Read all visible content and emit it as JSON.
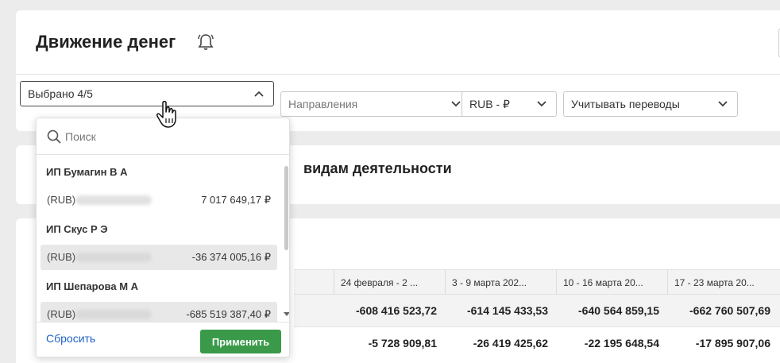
{
  "page": {
    "title": "Движение денег"
  },
  "filters": {
    "company": {
      "value": "Выбрано 4/5"
    },
    "direction": {
      "placeholder": "Направления"
    },
    "currency": {
      "value": "RUB - ₽"
    },
    "transfers": {
      "value": "Учитывать переводы"
    }
  },
  "section": {
    "title": "видам деятельности"
  },
  "table": {
    "headers": [
      "24 февраля - 2 ...",
      "3 - 9 марта 202...",
      "10 - 16 марта 20...",
      "17 - 23 марта 20..."
    ],
    "rows": [
      {
        "values": [
          "-608 416 523,72",
          "-614 145 433,53",
          "-640 564 859,15",
          "-662 760 507,69"
        ]
      },
      {
        "values": [
          "-5 728 909,81",
          "-26 419 425,62",
          "-22 195 648,54",
          "-17 895 907,06"
        ]
      }
    ]
  },
  "dropdown": {
    "search_placeholder": "Поиск",
    "groups": [
      {
        "name": "ИП Бумагин В А",
        "option": {
          "currency": "(RUB)",
          "amount": "7 017 649,17 ₽",
          "selected": false
        }
      },
      {
        "name": "ИП Скус Р Э",
        "option": {
          "currency": "(RUB)",
          "amount": "-36 374 005,16 ₽",
          "selected": true
        }
      },
      {
        "name": "ИП Шепарова М А",
        "option": {
          "currency": "(RUB)",
          "amount": "-685 519 387,40 ₽",
          "selected": true
        }
      }
    ],
    "reset_label": "Сбросить",
    "apply_label": "Применить"
  },
  "colors": {
    "apply": "#3a9a4a",
    "link": "#1e63c6"
  },
  "icons": [
    "bell-icon",
    "chevron-up-icon",
    "chevron-down-icon",
    "search-icon",
    "hand-cursor-icon"
  ]
}
